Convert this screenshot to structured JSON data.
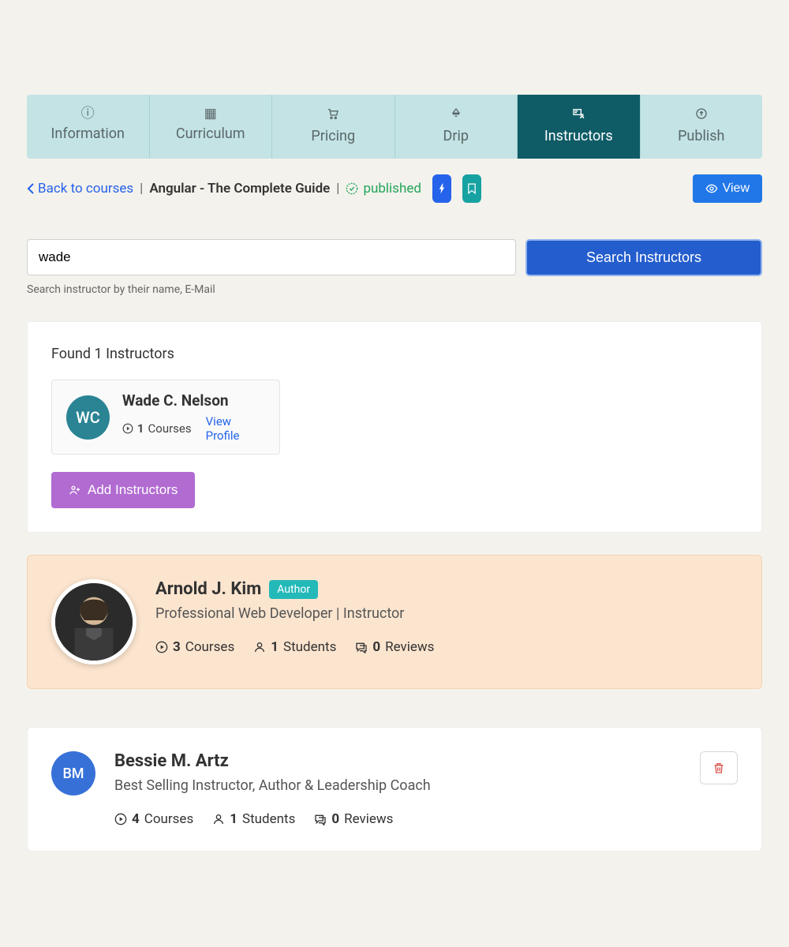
{
  "tabs": [
    {
      "label": "Information"
    },
    {
      "label": "Curriculum"
    },
    {
      "label": "Pricing"
    },
    {
      "label": "Drip"
    },
    {
      "label": "Instructors"
    },
    {
      "label": "Publish"
    }
  ],
  "breadcrumb": {
    "back": "Back to courses",
    "course": "Angular - The Complete Guide",
    "status": "published",
    "view": "View"
  },
  "search": {
    "value": "wade",
    "button": "Search Instructors",
    "helper": "Search instructor by their name, E-Mail"
  },
  "results": {
    "found": "Found 1 Instructors",
    "item": {
      "initials": "WC",
      "name": "Wade C. Nelson",
      "courses_count": "1",
      "courses_label": "Courses",
      "view_profile": "View Profile"
    },
    "add": "Add Instructors"
  },
  "featured": {
    "name": "Arnold J. Kim",
    "badge": "Author",
    "subtitle": "Professional Web Developer | Instructor",
    "courses_n": "3",
    "courses_l": "Courses",
    "students_n": "1",
    "students_l": "Students",
    "reviews_n": "0",
    "reviews_l": "Reviews"
  },
  "listed": {
    "initials": "BM",
    "name": "Bessie M. Artz",
    "subtitle": "Best Selling Instructor, Author & Leadership Coach",
    "courses_n": "4",
    "courses_l": "Courses",
    "students_n": "1",
    "students_l": "Students",
    "reviews_n": "0",
    "reviews_l": "Reviews"
  }
}
